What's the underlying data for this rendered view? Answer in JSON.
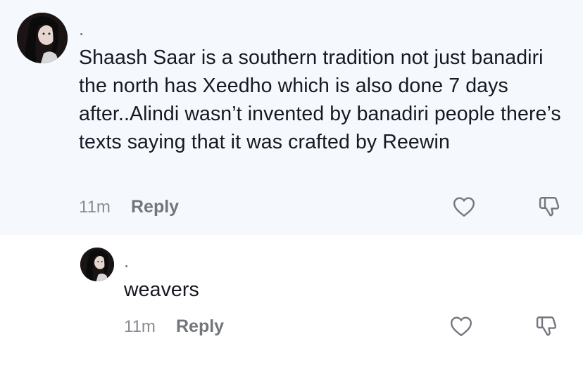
{
  "comment": {
    "username": ".",
    "text": "Shaash Saar is a southern tradition not just banadiri the north has Xeedho which is also done 7 days after..Alindi wasn’t invented by banadiri people there’s texts saying that it was crafted by Reewin",
    "time": "11m",
    "reply_label": "Reply"
  },
  "reply": {
    "username": ".",
    "text": "weavers",
    "time": "11m",
    "reply_label": "Reply"
  },
  "icons": {
    "like": "heart-outline-icon",
    "dislike": "thumbs-down-outline-icon"
  },
  "colors": {
    "highlight_bg": "#f5f9fd",
    "text": "#161823",
    "secondary": "#8a8b91"
  }
}
